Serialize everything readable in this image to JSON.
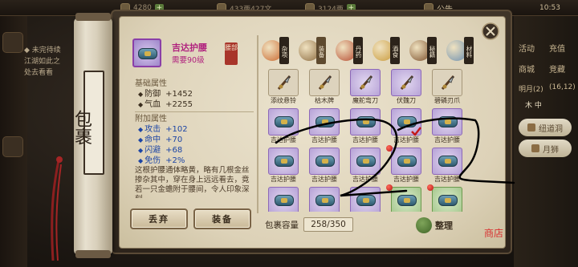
{
  "topbar": {
    "gold": "4280",
    "silver": "433两427文",
    "ingot": "3124两",
    "notice": "公告",
    "time": "10:53"
  },
  "quest": {
    "line1": "◆ 未完待续",
    "line2": "江湖如此之",
    "line3": "处去看看"
  },
  "right_menu": {
    "activity": "活动",
    "shop": "商城",
    "recharge": "充值",
    "bid": "竞藏",
    "moon": "明月(2)",
    "coord": "(16,12)",
    "tabs": "木 中",
    "pill1": "纽道洞",
    "pill2": "月狮"
  },
  "rod": {
    "title": "包裹"
  },
  "item": {
    "name": "吉达护腰",
    "requirement": "需要90级",
    "slot": "腰部",
    "base_title": "基础属性",
    "base": [
      {
        "label": "防御",
        "value": "+1452"
      },
      {
        "label": "气血",
        "value": "+2255"
      }
    ],
    "extra_title": "附加属性",
    "extra": [
      {
        "label": "攻击",
        "value": "+102"
      },
      {
        "label": "命中",
        "value": "+70"
      },
      {
        "label": "闪避",
        "value": "+68"
      },
      {
        "label": "免伤",
        "value": "+2%"
      }
    ],
    "description": "这根护腰通体略黄，略有几根金丝掺杂其中，穿在身上远远看去，竟若一只金蟾附于腰间，令人印象深刻。"
  },
  "buttons": {
    "discard": "丢弃",
    "equip": "装备",
    "sort": "整理"
  },
  "categories": [
    {
      "label": "杂项",
      "color": "#c9662d"
    },
    {
      "label": "装备",
      "color": "#8b6a3f"
    },
    {
      "label": "丹药",
      "color": "#b54a30"
    },
    {
      "label": "酒食",
      "color": "#c99a3a"
    },
    {
      "label": "秘籍",
      "color": "#7a4e2a"
    },
    {
      "label": "材料",
      "color": "#6c8fb0"
    }
  ],
  "grid": {
    "rows": [
      [
        {
          "name": "添纹悬铃",
          "kind": "misc",
          "bg": "plain",
          "icon": "bell-icon"
        },
        {
          "name": "枯木牌",
          "kind": "misc",
          "bg": "plain",
          "icon": "token-icon"
        },
        {
          "name": "魔舵弯刀",
          "kind": "misc",
          "bg": "purple",
          "icon": "sabre-icon"
        },
        {
          "name": "伏魏刀",
          "kind": "misc",
          "bg": "purple",
          "icon": "blade-icon"
        },
        {
          "name": "碧磷刃爪",
          "kind": "misc",
          "bg": "plain",
          "icon": "claw-icon"
        }
      ],
      [
        {
          "name": "吉达护腰",
          "kind": "belt",
          "bg": "purple"
        },
        {
          "name": "吉达护腰",
          "kind": "belt",
          "bg": "purple"
        },
        {
          "name": "吉达护腰",
          "kind": "belt",
          "bg": "purple"
        },
        {
          "name": "吉达护腰",
          "kind": "belt",
          "bg": "purple",
          "check": true
        },
        {
          "name": "吉达护腰",
          "kind": "belt",
          "bg": "purple"
        }
      ],
      [
        {
          "name": "吉达护腰",
          "kind": "belt",
          "bg": "purple"
        },
        {
          "name": "吉达护腰",
          "kind": "belt",
          "bg": "purple"
        },
        {
          "name": "吉达护腰",
          "kind": "belt",
          "bg": "purple"
        },
        {
          "name": "吉达护腰",
          "kind": "belt",
          "bg": "purple",
          "dot": true
        },
        {
          "name": "吉达护腰",
          "kind": "belt",
          "bg": "purple"
        }
      ],
      [
        {
          "name": "",
          "kind": "belt",
          "bg": "purple"
        },
        {
          "name": "",
          "kind": "belt",
          "bg": "purple"
        },
        {
          "name": "",
          "kind": "belt",
          "bg": "purple"
        },
        {
          "name": "",
          "kind": "belt",
          "bg": "green",
          "dot": true
        },
        {
          "name": "",
          "kind": "belt",
          "bg": "green",
          "dot": true
        }
      ]
    ]
  },
  "capacity": {
    "label": "包裹容量",
    "value": "258/350"
  },
  "stamp": "商店"
}
